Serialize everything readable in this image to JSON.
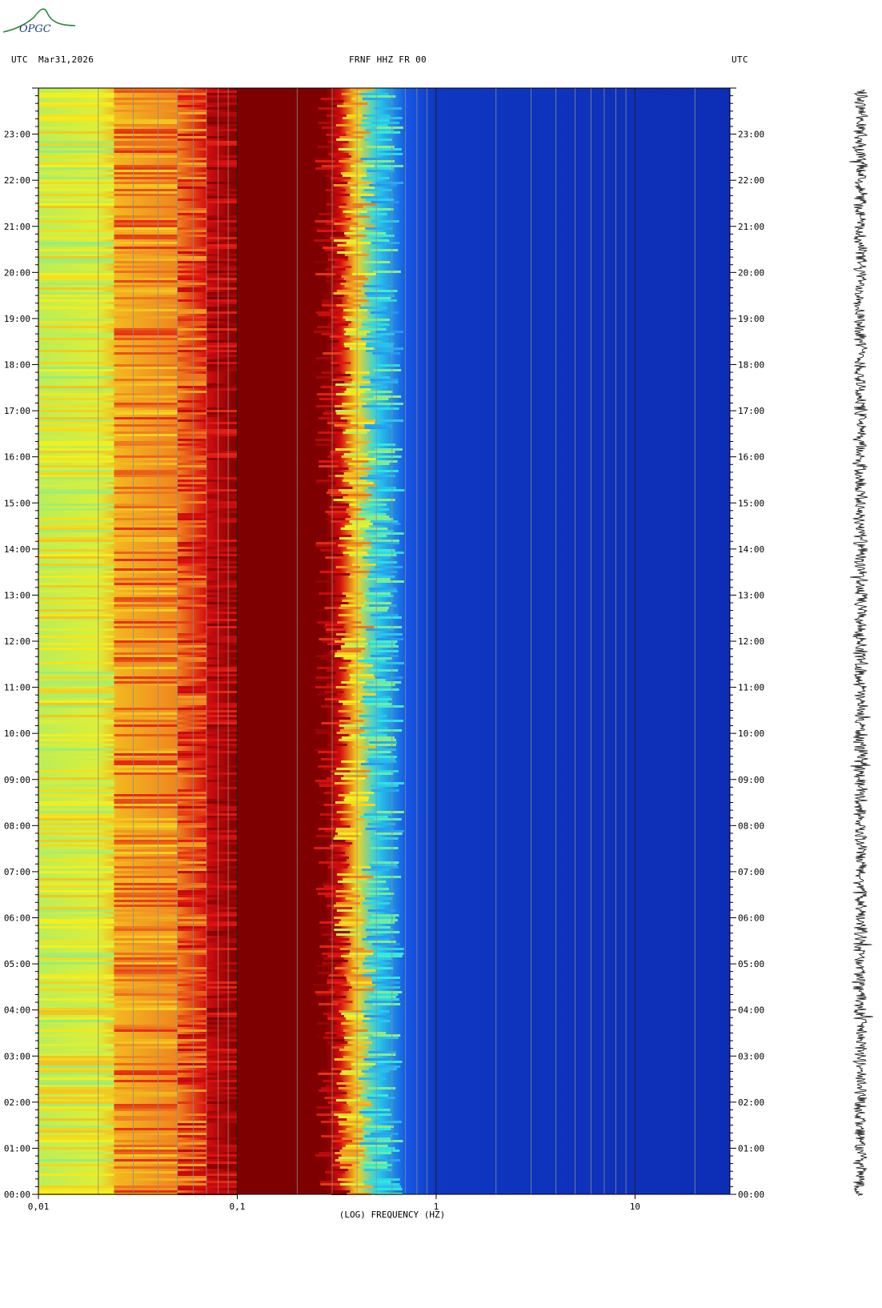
{
  "header": {
    "left_tz": "UTC",
    "date": "Mar31,2026",
    "station": "FRNF HHZ FR 00",
    "right_tz": "UTC"
  },
  "logo": {
    "text": "OPGC"
  },
  "colors": {
    "low": "#0a1fa6",
    "mid_cyan": "#30e8e0",
    "mid_yellow": "#f4f020",
    "high": "#7f0000",
    "grid": "#8c8c8c"
  },
  "chart_data": {
    "type": "heatmap",
    "title": "FRNF HHZ FR 00",
    "xlabel": "(LOG) FREQUENCY (HZ)",
    "xscale": "log",
    "xlim": [
      0.01,
      30
    ],
    "x_ticks": [
      "0,01",
      "0,1",
      "1",
      "10"
    ],
    "x_tick_values": [
      0.01,
      0.1,
      1,
      10
    ],
    "ylabel": "UTC",
    "ylim_hours": [
      0,
      24
    ],
    "y_ticks": [
      "00:00",
      "01:00",
      "02:00",
      "03:00",
      "04:00",
      "05:00",
      "06:00",
      "07:00",
      "08:00",
      "09:00",
      "10:00",
      "11:00",
      "12:00",
      "13:00",
      "14:00",
      "15:00",
      "16:00",
      "17:00",
      "18:00",
      "19:00",
      "20:00",
      "21:00",
      "22:00",
      "23:00"
    ],
    "grid": "vertical lines at each frequency decade subdivision",
    "colorscale": [
      "#0a1fa6",
      "#1b6fff",
      "#30e8e0",
      "#f4f020",
      "#f09020",
      "#e01010",
      "#7f0000"
    ],
    "band_profile": {
      "frequencies_hz": [
        0.01,
        0.02,
        0.025,
        0.05,
        0.07,
        0.1,
        0.28,
        0.33,
        0.4,
        0.5,
        0.7,
        1,
        30
      ],
      "relative_power": [
        0.45,
        0.48,
        0.6,
        0.68,
        0.85,
        1.0,
        1.0,
        0.85,
        0.55,
        0.3,
        0.12,
        0.05,
        0.03
      ]
    }
  },
  "trace": {
    "description_visible": false
  }
}
